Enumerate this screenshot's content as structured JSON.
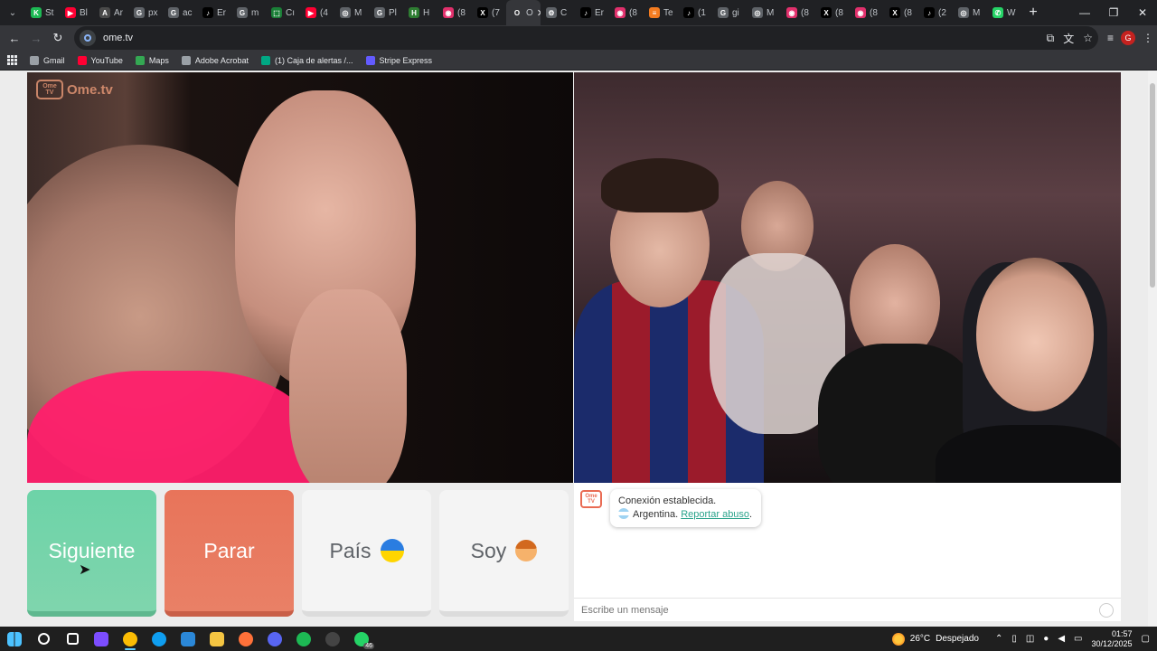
{
  "browser": {
    "tabs": [
      {
        "label": "St",
        "color": "#1db954",
        "glyph": "K"
      },
      {
        "label": "Bl",
        "color": "#ff0033",
        "glyph": "▶"
      },
      {
        "label": "Ar",
        "color": "#4a4a4a",
        "glyph": "A"
      },
      {
        "label": "px",
        "color": "#5f6368",
        "glyph": "G"
      },
      {
        "label": "ac",
        "color": "#5f6368",
        "glyph": "G"
      },
      {
        "label": "Er",
        "color": "#000000",
        "glyph": "♪"
      },
      {
        "label": "m",
        "color": "#5f6368",
        "glyph": "G"
      },
      {
        "label": "Cı",
        "color": "#1a7f37",
        "glyph": "⬚"
      },
      {
        "label": "(4",
        "color": "#ff0033",
        "glyph": "▶"
      },
      {
        "label": "M",
        "color": "#5f6368",
        "glyph": "◎"
      },
      {
        "label": "Pl",
        "color": "#5f6368",
        "glyph": "G"
      },
      {
        "label": "H",
        "color": "#2e7d32",
        "glyph": "H"
      },
      {
        "label": "(8",
        "color": "#e1306c",
        "glyph": "◉"
      },
      {
        "label": "(7",
        "color": "#000000",
        "glyph": "X"
      },
      {
        "label": "O",
        "color": "#35363a",
        "glyph": "O"
      },
      {
        "label": "C",
        "color": "#5f6368",
        "glyph": "⚙"
      },
      {
        "label": "Er",
        "color": "#000000",
        "glyph": "♪"
      },
      {
        "label": "(8",
        "color": "#e1306c",
        "glyph": "◉"
      },
      {
        "label": "Te",
        "color": "#f47c20",
        "glyph": "≡"
      },
      {
        "label": "(1",
        "color": "#000000",
        "glyph": "♪"
      },
      {
        "label": "gi",
        "color": "#5f6368",
        "glyph": "G"
      },
      {
        "label": "M",
        "color": "#5f6368",
        "glyph": "◎"
      },
      {
        "label": "(8",
        "color": "#e1306c",
        "glyph": "◉"
      },
      {
        "label": "(8",
        "color": "#000000",
        "glyph": "X"
      },
      {
        "label": "(8",
        "color": "#e1306c",
        "glyph": "◉"
      },
      {
        "label": "(8",
        "color": "#000000",
        "glyph": "X"
      },
      {
        "label": "(2",
        "color": "#000000",
        "glyph": "♪"
      },
      {
        "label": "M",
        "color": "#5f6368",
        "glyph": "◎"
      },
      {
        "label": "W",
        "color": "#25d366",
        "glyph": "✆"
      }
    ],
    "active_tab_index": 14,
    "url": "ome.tv",
    "bookmarks": [
      {
        "label": "Gmail",
        "color": "#9aa0a6"
      },
      {
        "label": "YouTube",
        "color": "#ff0033"
      },
      {
        "label": "Maps",
        "color": "#34a853"
      },
      {
        "label": "Adobe Acrobat",
        "color": "#9aa0a6"
      },
      {
        "label": "(1) Caja de alertas /...",
        "color": "#00a884"
      },
      {
        "label": "Stripe Express",
        "color": "#635bff"
      }
    ],
    "profile_initial": "G"
  },
  "page": {
    "logo_tv_text": "Ome TV",
    "logo_brand": "Ome.tv",
    "buttons": {
      "next": "Siguiente",
      "stop": "Parar",
      "country": "País",
      "gender": "Soy"
    },
    "chat": {
      "logo_text": "Ome TV",
      "status": "Conexión establecida.",
      "country": "Argentina.",
      "report": "Reportar abuso",
      "report_suffix": ".",
      "input_placeholder": "Escribe un mensaje"
    },
    "colors": {
      "next": "#6dd3a8",
      "stop": "#e8745a",
      "accent": "#2aa38b"
    }
  },
  "taskbar": {
    "apps": [
      {
        "name": "start",
        "color": "#ffffff"
      },
      {
        "name": "search",
        "color": "#ffffff"
      },
      {
        "name": "task-view",
        "color": "#ffffff"
      },
      {
        "name": "copilot",
        "color": "#7c4dff"
      },
      {
        "name": "chrome",
        "color": "#fbbc04"
      },
      {
        "name": "edge",
        "color": "#0f9ef0"
      },
      {
        "name": "store",
        "color": "#2b88d8"
      },
      {
        "name": "explorer",
        "color": "#f4c542"
      },
      {
        "name": "firefox",
        "color": "#ff7139"
      },
      {
        "name": "discord",
        "color": "#5865f2"
      },
      {
        "name": "spotify",
        "color": "#1db954"
      },
      {
        "name": "obs",
        "color": "#444444"
      },
      {
        "name": "whatsapp",
        "color": "#25d366"
      }
    ],
    "whatsapp_badge": "46",
    "weather_temp": "26°C",
    "weather_text": "Despejado",
    "time": "01:57",
    "date": "30/12/2025"
  }
}
